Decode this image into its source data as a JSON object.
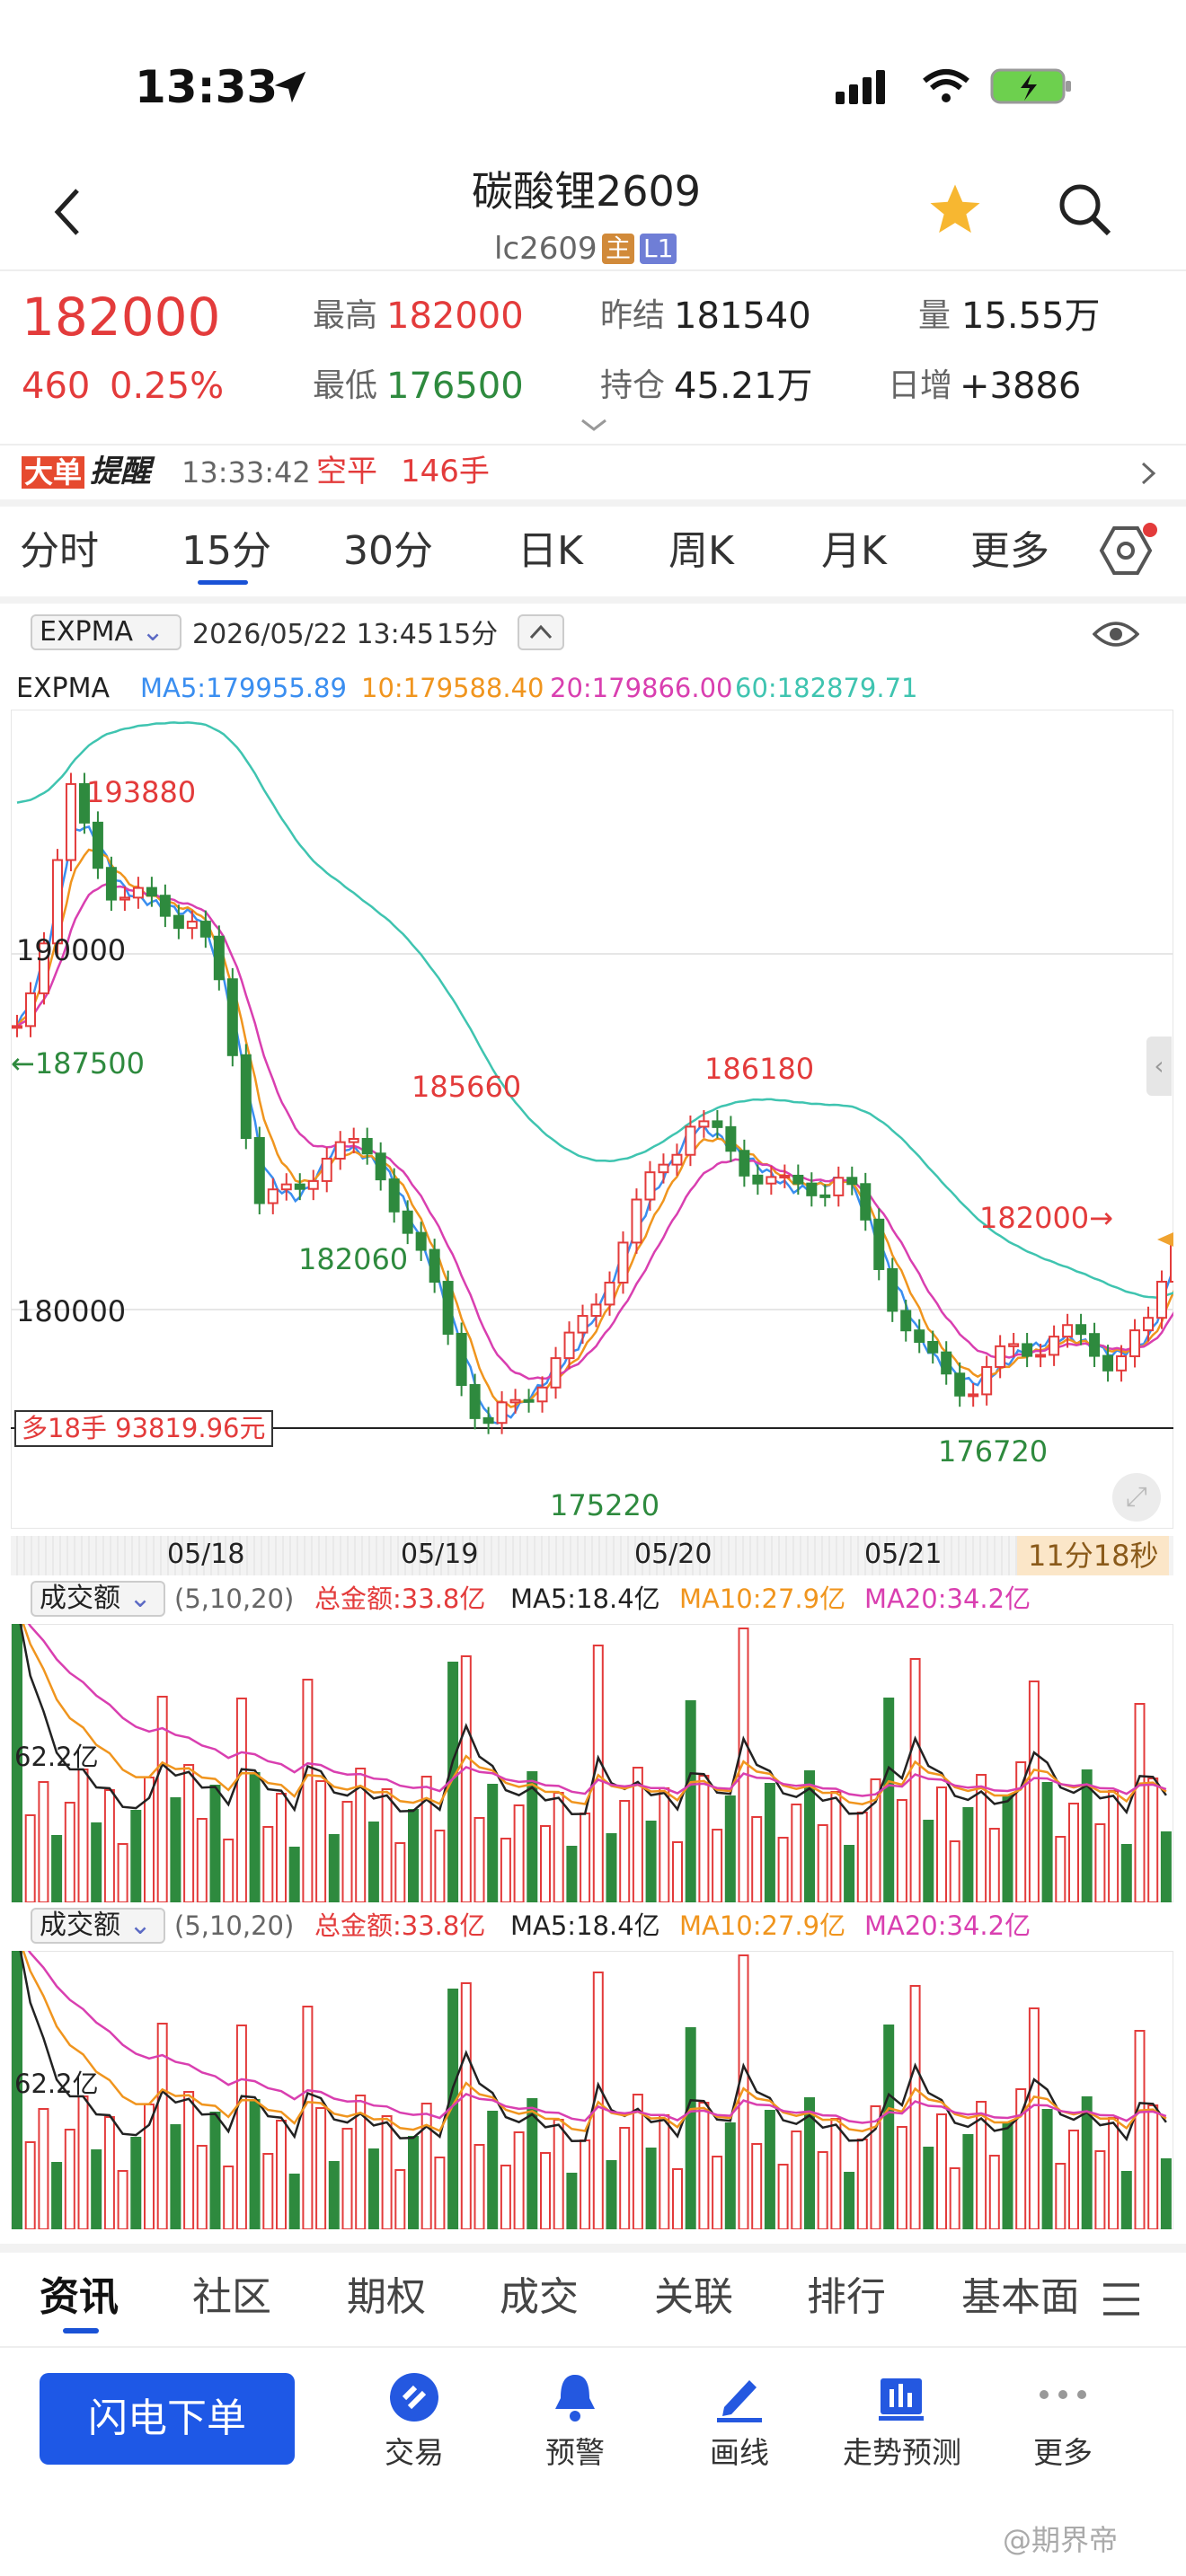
{
  "status_bar": {
    "time": "13:33"
  },
  "header": {
    "title": "碳酸锂2609",
    "subtitle": "lc2609",
    "badge_main": "主",
    "badge_l1": "L1"
  },
  "quote": {
    "last": "182000",
    "change": "460",
    "change_pct": "0.25%",
    "high_label": "最高",
    "high": "182000",
    "low_label": "最低",
    "low": "176500",
    "prev_label": "昨结",
    "prev": "181540",
    "oi_label": "持仓",
    "oi": "45.21万",
    "vol_label": "量",
    "vol": "15.55万",
    "daily_inc_label": "日增",
    "daily_inc": "+3886"
  },
  "alert": {
    "tag1": "大单",
    "tag2": "提醒",
    "time": "13:33:42",
    "type": "空平",
    "qty": "146手"
  },
  "period_tabs": [
    "分时",
    "15分",
    "30分",
    "日K",
    "周K",
    "月K",
    "更多"
  ],
  "active_period": "15分",
  "toolbar": {
    "indicator": "EXPMA",
    "datetime": "2026/05/22 13:45",
    "period": "15分"
  },
  "expma": {
    "label": "EXPMA",
    "ma5": "MA5:179955.89",
    "ma10": "10:179588.40",
    "ma20": "20:179866.00",
    "ma60": "60:182879.71"
  },
  "colors": {
    "up": "#e33b3b",
    "down": "#2e8a3e",
    "ma5": "#3a8ef0",
    "ma10": "#f0951e",
    "ma20": "#d93fb0",
    "ma60": "#3fc4b0",
    "accent": "#1a52d6"
  },
  "price_labels": {
    "high_mark": "193880",
    "y_upper": "190000",
    "left_mark": "←187500",
    "mid_high": "185660",
    "local_low1": "182060",
    "peak2": "186180",
    "current": "182000→",
    "y_lower": "180000",
    "low_mark": "175220",
    "low2": "176720",
    "position_line": "多18手 93819.96元"
  },
  "x_axis": {
    "dates": [
      "05/18",
      "05/19",
      "05/20",
      "05/21"
    ],
    "countdown": "11分18秒"
  },
  "volume_panel": {
    "indicator": "成交额",
    "params": "(5,10,20)",
    "total": "总金额:33.8亿",
    "ma5": "MA5:18.4亿",
    "ma10": "MA10:27.9亿",
    "ma20": "MA20:34.2亿",
    "scale": "62.2亿"
  },
  "bottom_tabs": [
    "资讯",
    "社区",
    "期权",
    "成交",
    "关联",
    "排行",
    "基本面"
  ],
  "actions": {
    "flash_order": "闪电下单",
    "trade": "交易",
    "alert": "预警",
    "draw": "画线",
    "forecast": "走势预测",
    "more": "更多"
  },
  "watermark": "@期界帝",
  "chart_data": {
    "type": "candlestick",
    "title": "碳酸锂2609 15分",
    "x": [
      "05/18",
      "05/19",
      "05/20",
      "05/21"
    ],
    "ylim": [
      174000,
      196000
    ],
    "marked_values": {
      "high": 193880,
      "low": 175220,
      "current": 182000,
      "local_highs": [
        185660,
        186180
      ],
      "local_lows": [
        182060,
        176720
      ],
      "left": 187500
    },
    "series": [
      {
        "name": "MA5",
        "value": 179955.89
      },
      {
        "name": "10",
        "value": 179588.4
      },
      {
        "name": "20",
        "value": 179866.0
      },
      {
        "name": "60",
        "value": 182879.71
      }
    ]
  }
}
